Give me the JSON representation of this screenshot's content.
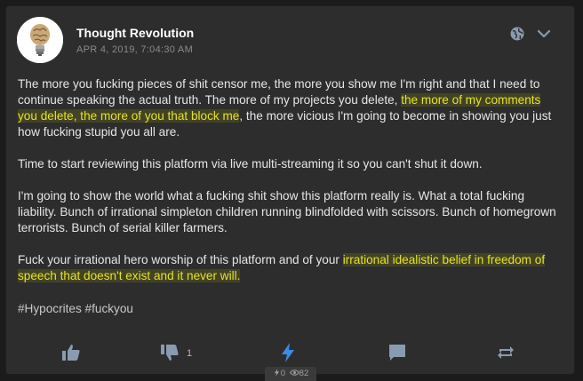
{
  "post": {
    "author": "Thought Revolution",
    "timestamp": "APR 4, 2019, 7:04:30 AM",
    "paragraphs": {
      "p1_a": "The more you fucking pieces of shit censor me, the more you show me I'm right and that I need to continue speaking the actual truth. The more of my projects you delete, ",
      "p1_hl1": "the more of my comments you delete",
      "p1_sep": ", ",
      "p1_hl2": "the more of you that block me",
      "p1_b": ", the more vicious I'm going to become in showing you just how fucking stupid you all are.",
      "p2": "Time to start reviewing this platform via live multi-streaming it so you can't shut it down.",
      "p3": "I'm going to show the world what a fucking shit show this platform really is. What a total fucking liability. Bunch of irrational simpleton children running blindfolded with scissors. Bunch of homegrown terrorists. Bunch of serial killer farmers.",
      "p4_a": "Fuck your irrational hero worship of this platform and of your ",
      "p4_hl": "irrational idealistic belief in freedom of speech that doesn't exist and it never will.",
      "p4_b": ""
    },
    "hashtags": "#Hypocrites #fuckyou"
  },
  "actions": {
    "downvote_count": "1",
    "boost_count": "0",
    "view_count": "82"
  },
  "colors": {
    "accent": "#3d8be6",
    "highlight_text": "#e3e327",
    "icon": "#8a9ab0"
  },
  "icons": [
    "globe-icon",
    "chevron-down-icon",
    "thumbs-up-icon",
    "thumbs-down-icon",
    "lightning-icon",
    "comment-icon",
    "repeat-icon",
    "eye-icon"
  ]
}
